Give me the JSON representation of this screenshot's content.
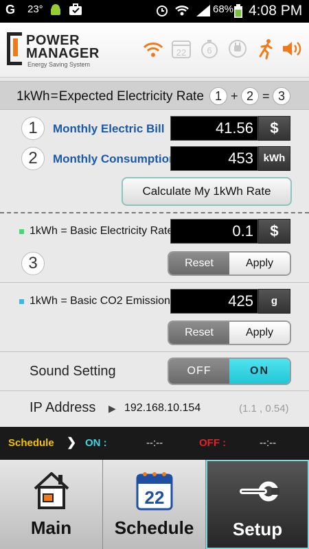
{
  "status_bar": {
    "temperature": "23°",
    "battery": "68%",
    "time": "4:08 PM"
  },
  "header": {
    "logo_line1": "POWER",
    "logo_line2": "MANAGER",
    "logo_subtitle": "Energy Saving System",
    "calendar_date": "22",
    "timer_number": "6",
    "icons": [
      "wifi-icon",
      "calendar-icon",
      "timer-icon",
      "plug-icon",
      "running-man-icon",
      "speaker-icon"
    ],
    "accent_color": "#f07a1a"
  },
  "formula": {
    "lhs": "1kWh",
    "eq": "=",
    "text": "Expected Electricity Rate",
    "n1": "1",
    "plus": "+",
    "n2": "2",
    "eq2": "=",
    "n3": "3"
  },
  "bill": {
    "number": "1",
    "label": "Monthly Electric Bill",
    "value": "41.56",
    "unit": "$"
  },
  "consumption": {
    "number": "2",
    "label": "Monthly Consumption",
    "value": "453",
    "unit": "kWh"
  },
  "calculate_button": "Calculate My 1kWh Rate",
  "basic_rate": {
    "label": "1kWh = Basic Electricity Rate",
    "value": "0.1",
    "unit": "$",
    "number": "3",
    "reset": "Reset",
    "apply": "Apply",
    "dot_color": "#3ddc74"
  },
  "co2": {
    "label": "1kWh = Basic CO2 Emission",
    "value": "425",
    "unit": "g",
    "reset": "Reset",
    "apply": "Apply",
    "dot_color": "#38b8e8"
  },
  "sound": {
    "label": "Sound Setting",
    "off": "OFF",
    "on": "ON",
    "selected": "ON"
  },
  "ip": {
    "label": "IP Address",
    "arrow": "▶",
    "value": "192.168.10.154",
    "version": "(1.1 , 0.54)"
  },
  "schedule": {
    "label": "Schedule",
    "arrow": "❯",
    "on_label": "ON :",
    "on_value": "--:--",
    "off_label": "OFF :",
    "off_value": "--:--"
  },
  "nav": {
    "main": "Main",
    "schedule": "Schedule",
    "schedule_date": "22",
    "setup": "Setup",
    "active": "Setup"
  }
}
